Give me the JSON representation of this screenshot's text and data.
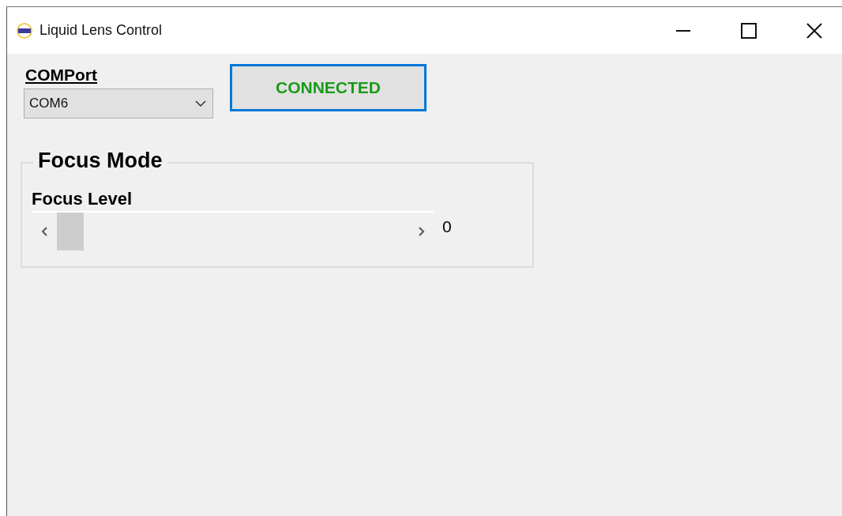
{
  "window": {
    "title": "Liquid Lens Control"
  },
  "com_port": {
    "label": "COMPort",
    "value": "COM6"
  },
  "connect_button": {
    "label": "CONNECTED"
  },
  "focus_mode": {
    "title": "Focus Mode",
    "focus_level": {
      "label": "Focus Level",
      "reading": "0"
    }
  }
}
